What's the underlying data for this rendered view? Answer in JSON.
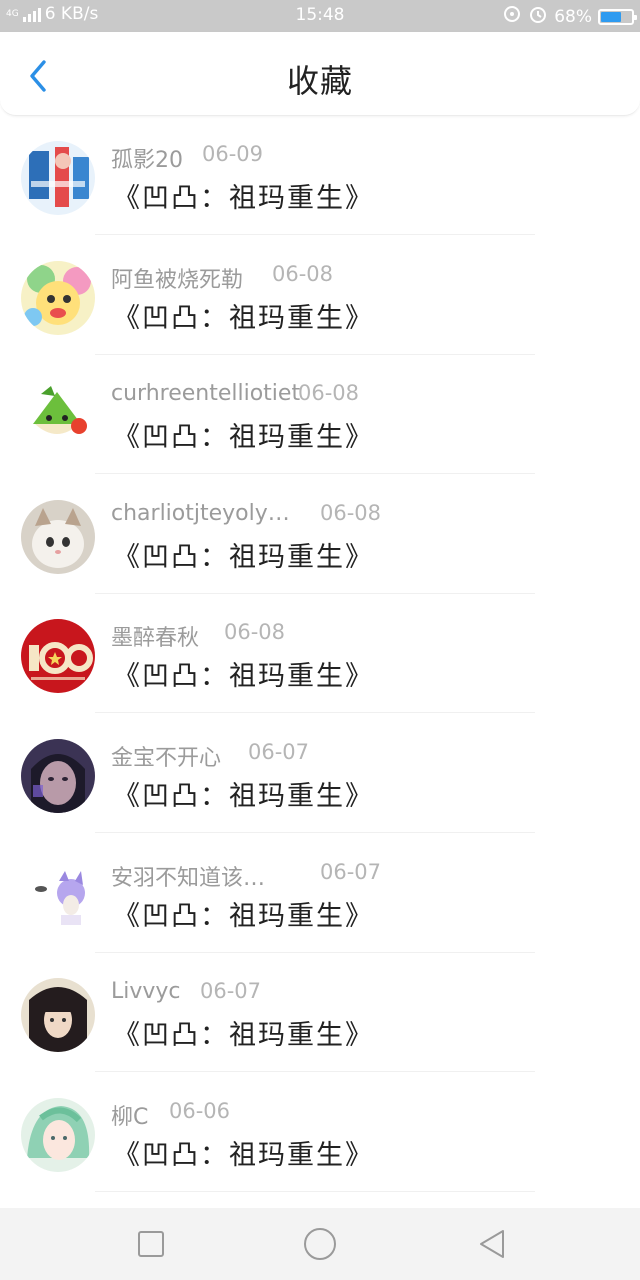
{
  "status_bar": {
    "network": "4G",
    "speed": "6 KB/s",
    "time": "15:48",
    "battery": "68%",
    "battery_level": 0.68,
    "accent": "#2f9bf0"
  },
  "header": {
    "title": "收藏",
    "back_icon": "chevron-left-icon",
    "accent": "#2b8fe6"
  },
  "favorites": [
    {
      "name": "孤影20",
      "date": "06-09",
      "title": "《凹凸：祖玛重生》"
    },
    {
      "name": "阿鱼被烧死勒",
      "date": "06-08",
      "title": "《凹凸：祖玛重生》"
    },
    {
      "name": "curhreentelliotiet",
      "date": "06-08",
      "title": "《凹凸：祖玛重生》"
    },
    {
      "name": "charliotjteyoly…",
      "date": "06-08",
      "title": "《凹凸：祖玛重生》"
    },
    {
      "name": "墨醉春秋",
      "date": "06-08",
      "title": "《凹凸：祖玛重生》"
    },
    {
      "name": "金宝不开心",
      "date": "06-07",
      "title": "《凹凸：祖玛重生》"
    },
    {
      "name": "安羽不知道该…",
      "date": "06-07",
      "title": "《凹凸：祖玛重生》"
    },
    {
      "name": "Livvyc",
      "date": "06-07",
      "title": "《凹凸：祖玛重生》"
    },
    {
      "name": "柳C",
      "date": "06-06",
      "title": "《凹凸：祖玛重生》"
    }
  ],
  "nav_bar": {
    "recent_icon": "square-icon",
    "home_icon": "circle-icon",
    "back_icon": "triangle-back-icon"
  }
}
